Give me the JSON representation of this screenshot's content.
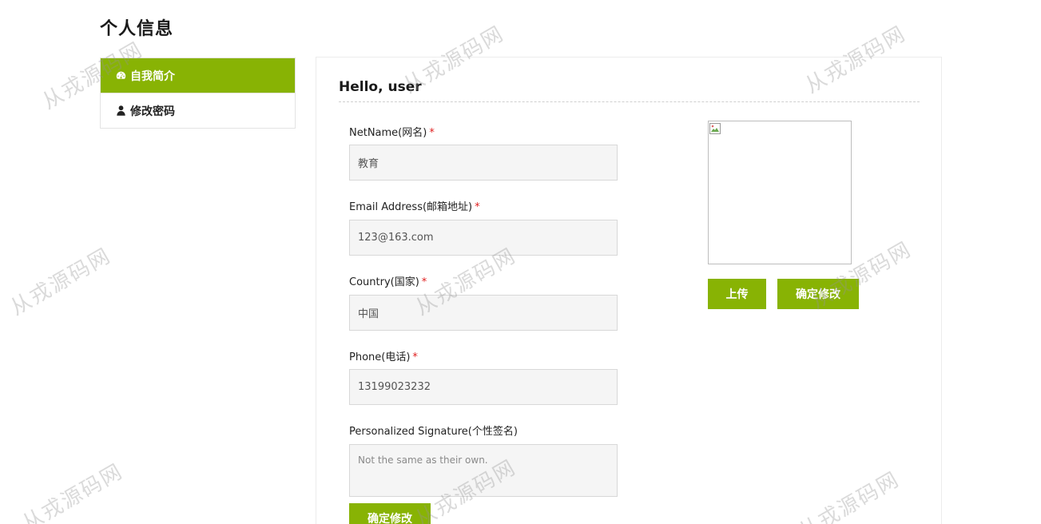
{
  "page": {
    "title": "个人信息"
  },
  "sidebar": {
    "items": [
      {
        "label": "自我简介",
        "icon": "dashboard-icon",
        "active": true
      },
      {
        "label": "修改密码",
        "icon": "user-icon",
        "active": false
      }
    ]
  },
  "main": {
    "greeting": "Hello, user",
    "fields": {
      "netname": {
        "label": "NetName(网名)",
        "required": "*",
        "value": "教育"
      },
      "email": {
        "label": "Email Address(邮箱地址)",
        "required": "*",
        "value": "123@163.com"
      },
      "country": {
        "label": "Country(国家)",
        "required": "*",
        "value": "中国"
      },
      "phone": {
        "label": "Phone(电话)",
        "required": "*",
        "value": "13199023232"
      },
      "signature": {
        "label": "Personalized Signature(个性签名)",
        "placeholder": "Not the same as their own."
      }
    },
    "submit_label": "确定修改",
    "avatar": {
      "upload_label": "上传",
      "confirm_label": "确定修改"
    }
  },
  "watermark": {
    "text": "从戎源码网"
  },
  "colors": {
    "accent": "#88b304",
    "required": "#e02020",
    "input_bg": "#f5f5f5"
  }
}
